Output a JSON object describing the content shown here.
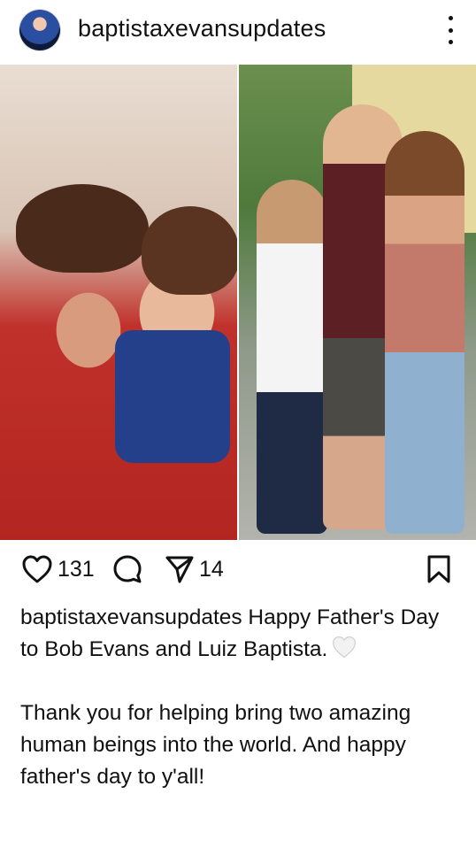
{
  "post": {
    "username": "baptistaxevansupdates",
    "likes": "131",
    "shares": "14",
    "caption_user": "baptistaxevansupdates",
    "caption_text": " Happy Father's Day to Bob Evans and Luiz Baptista.",
    "caption_emoji": "white-heart-icon",
    "caption_para2": "Thank you for helping bring two amazing human beings into the world. And happy father's day to y'all!"
  },
  "icons": {
    "more": "more-vertical-icon",
    "like": "heart-outline-icon",
    "comment": "comment-bubble-icon",
    "share": "send-icon",
    "save": "bookmark-icon"
  }
}
